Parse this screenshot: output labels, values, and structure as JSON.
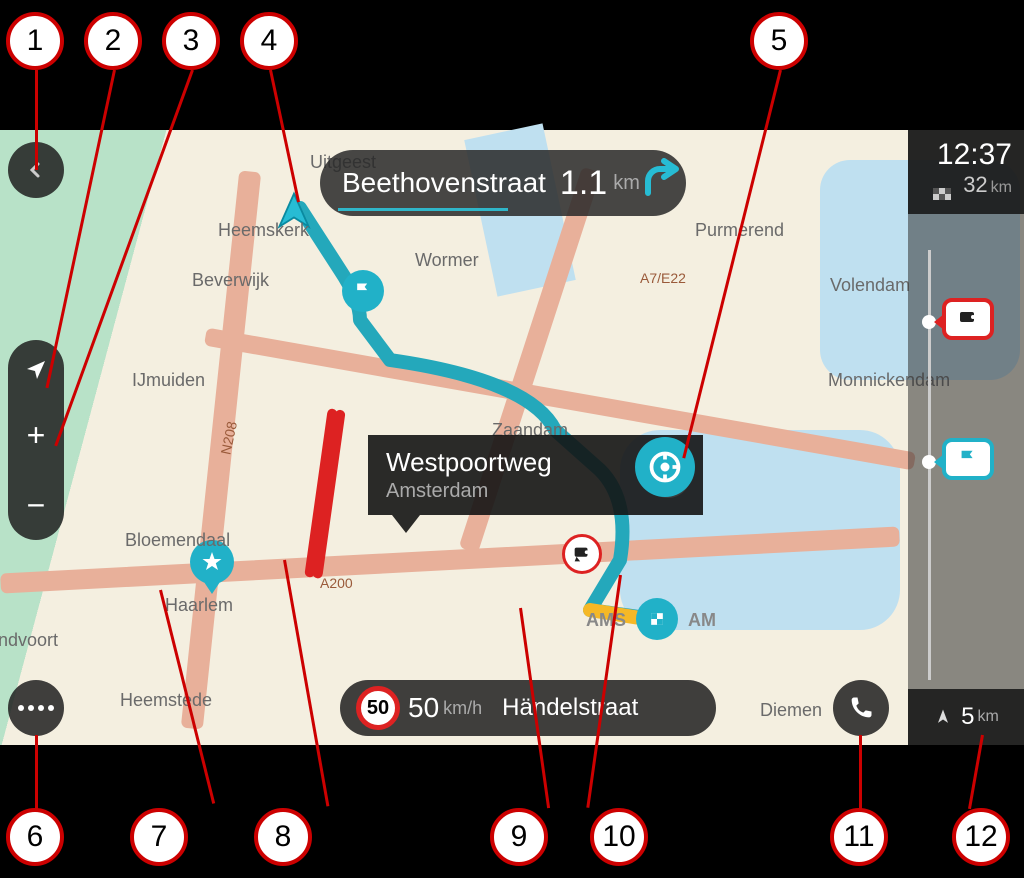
{
  "instruction": {
    "street": "Beethovenstraat",
    "distance_value": "1.1",
    "distance_unit": "km",
    "turn": "right"
  },
  "location_popup": {
    "title": "Westpoortweg",
    "subtitle": "Amsterdam"
  },
  "speed_panel": {
    "limit": "50",
    "current_speed": "50",
    "speed_unit": "km/h",
    "road_name": "Händelstraat"
  },
  "route_bar": {
    "time": "12:37",
    "distance_value": "32",
    "distance_unit": "km",
    "next_value": "5",
    "next_unit": "km"
  },
  "map_labels": {
    "heemskerk": "Heemskerk",
    "beverwijk": "Beverwijk",
    "ijmuiden": "IJmuiden",
    "bloemendaal": "Bloemendaal",
    "haarlem": "Haarlem",
    "heemstede": "Heemstede",
    "zandvoort": "ndvoort",
    "uitgeest": "Uitgeest",
    "wormer": "Wormer",
    "zaandam": "Zaandam",
    "purmerend": "Purmerend",
    "volendam": "Volendam",
    "monnickendam": "Monnickendam",
    "amsterdam_left": "AMS",
    "amsterdam_right": "AM",
    "diemen": "Diemen",
    "a7e22": "A7/E22",
    "n208": "N208",
    "a200": "A200"
  },
  "callouts": {
    "c1": "1",
    "c2": "2",
    "c3": "3",
    "c4": "4",
    "c5": "5",
    "c6": "6",
    "c7": "7",
    "c8": "8",
    "c9": "9",
    "c10": "10",
    "c11": "11",
    "c12": "12"
  }
}
